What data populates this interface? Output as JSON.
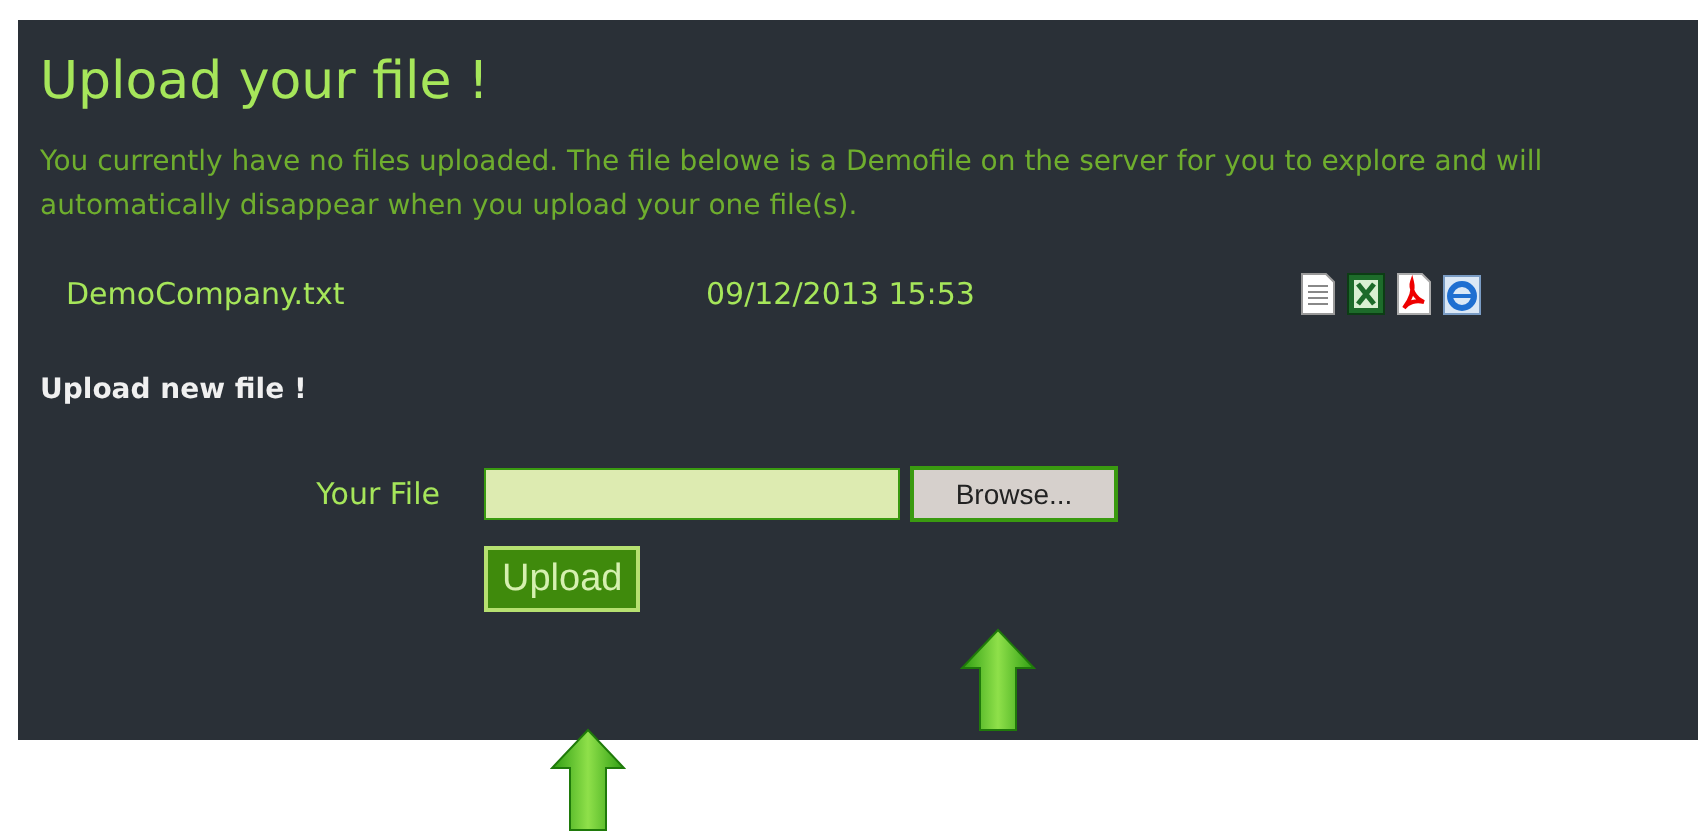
{
  "title": "Upload your file !",
  "intro": "You currently have no files uploaded. The file belowe is a Demofile on the server for you to explore and will automatically disappear when you upload your one file(s).",
  "files": [
    {
      "name": "DemoCompany.txt",
      "date": "09/12/2013 15:53"
    }
  ],
  "upload_heading": "Upload new file !",
  "form": {
    "label": "Your File",
    "browse": "Browse...",
    "submit": "Upload"
  }
}
